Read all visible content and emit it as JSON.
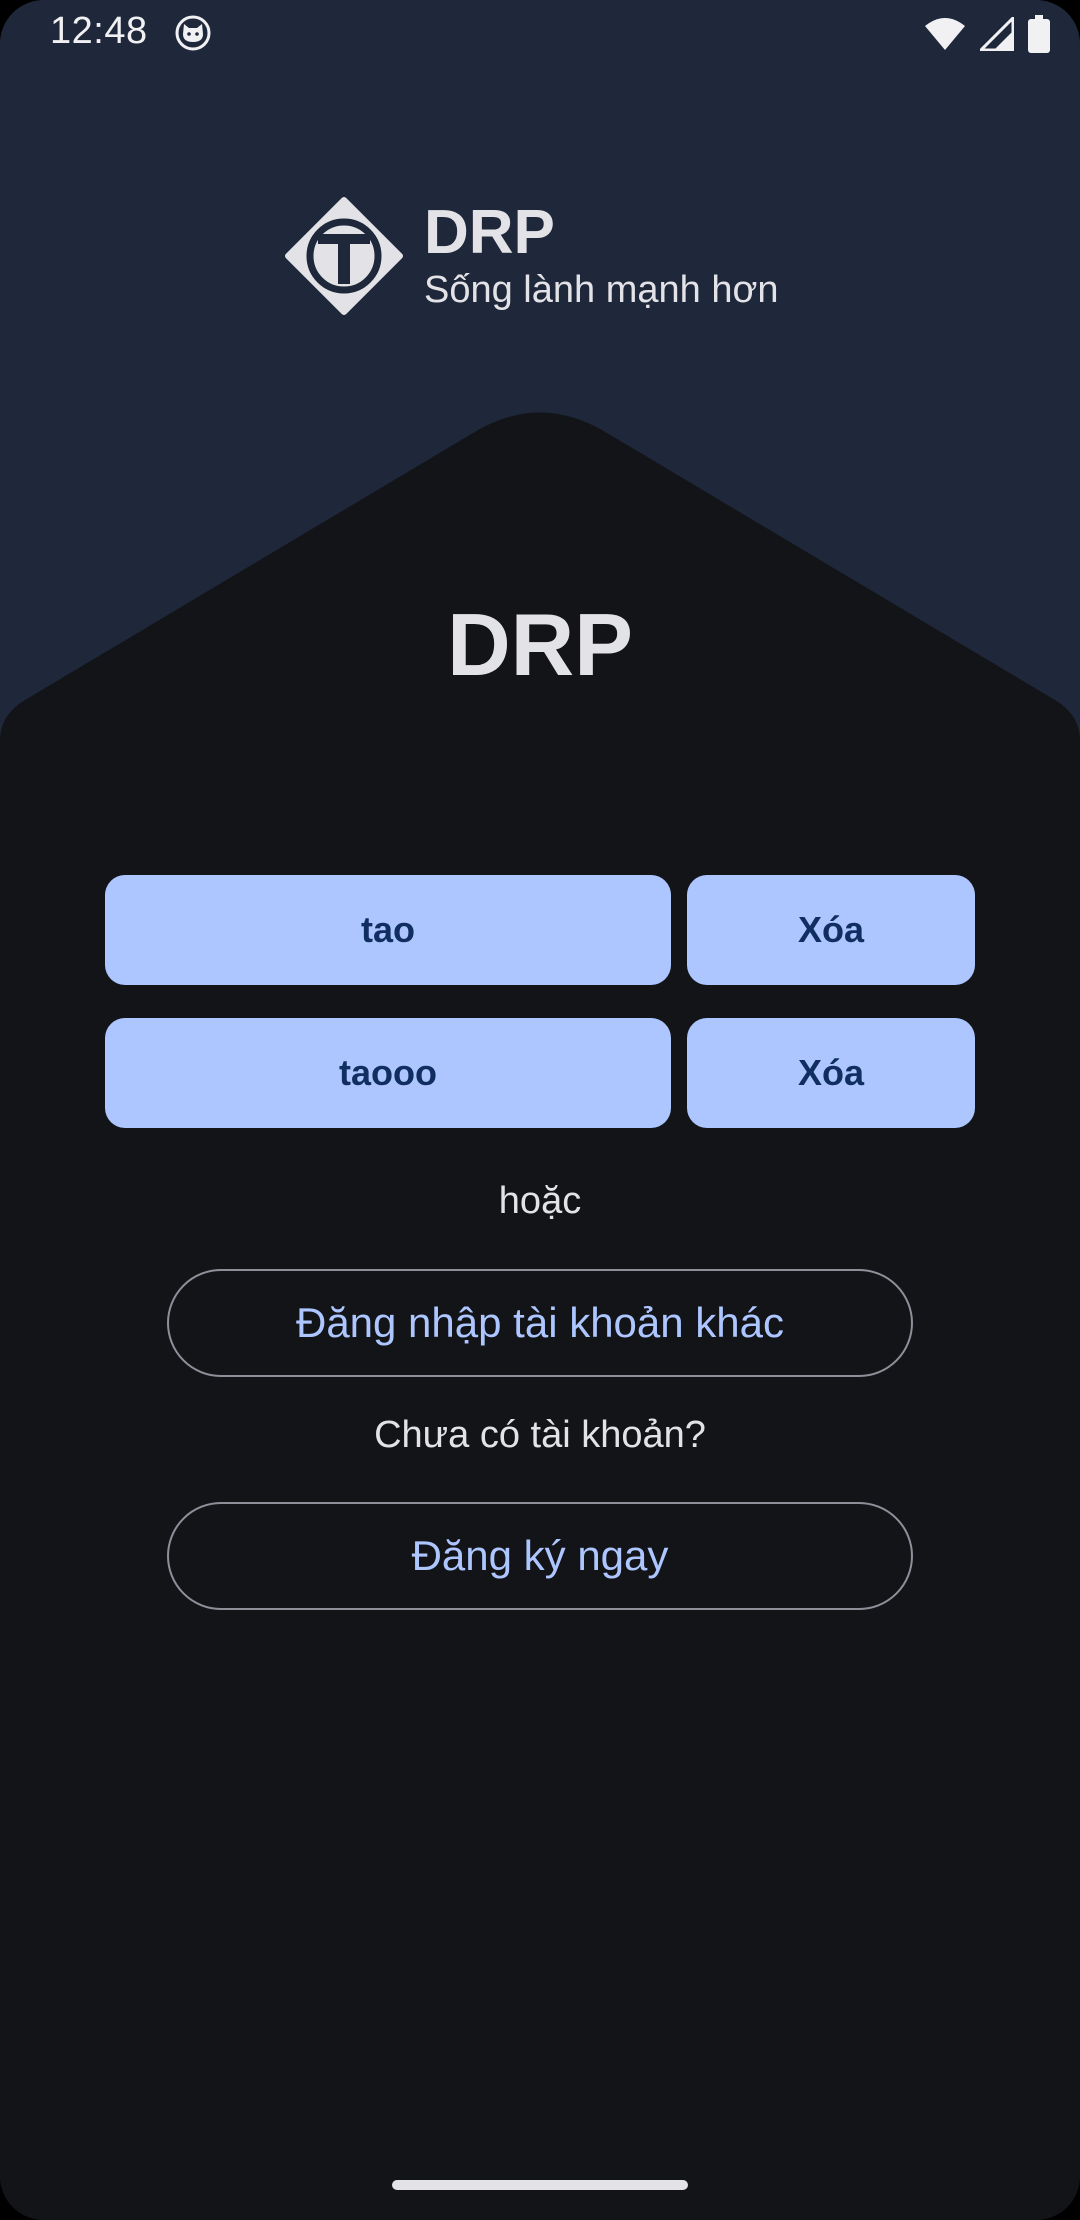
{
  "status_bar": {
    "time": "12:48",
    "icons": [
      "cat-notification-icon",
      "wifi-icon",
      "signal-icon",
      "battery-icon"
    ]
  },
  "brand": {
    "name": "DRP",
    "tagline": "Sống lành mạnh hơn",
    "logo_icon": "t-diamond-logo"
  },
  "app_title": "DRP",
  "saved_accounts": [
    {
      "username": "tao",
      "delete_label": "Xóa"
    },
    {
      "username": "taooo",
      "delete_label": "Xóa"
    }
  ],
  "or_text": "hoặc",
  "login_other_label": "Đăng nhập tài khoản khác",
  "no_account_text": "Chưa có tài khoản?",
  "register_label": "Đăng ký ngay",
  "colors": {
    "header_bg": "#1f283b",
    "body_bg": "#131418",
    "button_fill": "#adc6ff",
    "button_text": "#102f60",
    "outline_text": "#adc6ff"
  }
}
